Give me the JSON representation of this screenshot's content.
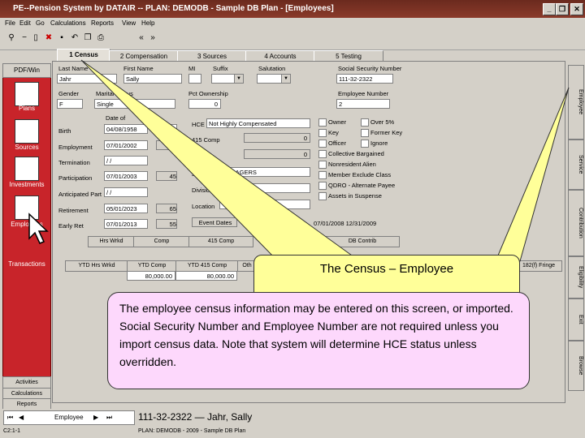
{
  "window": {
    "title": "PE--Pension System by DATAIR -- PLAN: DEMODB - Sample DB Plan - [Employees]",
    "minimize": "_",
    "restore": "❐",
    "close": "✕"
  },
  "menu": [
    "File",
    "Edit",
    "Go",
    "Calculations",
    "Reports",
    "View",
    "Help"
  ],
  "toolbar": {
    "prev": "«",
    "next": "»"
  },
  "sidebar": {
    "header": "PDF/Win",
    "items": [
      "Plans",
      "Sources",
      "Investments",
      "Employees",
      "Transactions"
    ],
    "bottom": [
      "Activities",
      "Calculations",
      "Reports"
    ]
  },
  "tabs": [
    "1 Census",
    "2 Compensation",
    "3 Sources",
    "4 Accounts",
    "5 Testing"
  ],
  "labels": {
    "last_name": "Last Name",
    "first_name": "First Name",
    "mi": "MI",
    "suffix": "Suffix",
    "salutation": "Salutation",
    "ssn": "Social Security Number",
    "gender": "Gender",
    "marital": "Marital Status",
    "pct_own": "Pct Ownership",
    "emp_num": "Employee Number",
    "date_of": "Date of",
    "birth": "Birth",
    "employment": "Employment",
    "termination": "Termination",
    "participation": "Participation",
    "ant_part": "Anticipated Part",
    "retirement": "Retirement",
    "early_ret": "Early Ret",
    "hce": "HCE",
    "c415": "415 Comp",
    "job": "Job",
    "division": "Division",
    "location": "Location",
    "event_dates": "Event Dates"
  },
  "values": {
    "last_name": "Jahr",
    "first_name": "Sally",
    "ssn": "111-32-2322",
    "gender": "F",
    "marital": "Single",
    "pct_own": "0",
    "emp_num": "2",
    "birth": "04/08/1958",
    "birth_age": "",
    "employment": "07/01/2002",
    "emp_yrs": "43",
    "termination": "/ /",
    "participation": "07/01/2003",
    "part_age": "45",
    "ant_part": "/ /",
    "retirement": "05/01/2023",
    "ret_age": "65",
    "early_ret": "07/01/2013",
    "early_age": "55",
    "hce": "Not Highly Compensated",
    "c415": "0",
    "ccomp": "0",
    "job": "MANAGERS",
    "range": "07/01/2008 12/31/2009"
  },
  "flags": [
    "Owner",
    "Over 5%",
    "Key",
    "Former Key",
    "Officer",
    "Ignore",
    "Collective Bargained",
    "Nonresident Alien",
    "Member Exclude Class",
    "QDRO - Alternate Payee",
    "Assets in Suspense"
  ],
  "right_tabs": [
    "Employee",
    "Service",
    "Contribution",
    "Eligibility",
    "Exit",
    "Browse"
  ],
  "grid": {
    "headers": [
      "Hrs Wrkd",
      "Comp",
      "415 Comp",
      "DB Contrib"
    ],
    "sub_headers": [
      "YTD Hrs Wrkd",
      "YTD Comp",
      "YTD 415 Comp",
      "Oth",
      "EP",
      "182(f) Fringe"
    ],
    "row": [
      "",
      "80,000.00",
      "80,000.00"
    ]
  },
  "callout_title": "The Census – Employee",
  "callout_text": "The employee census information may be entered on this screen, or imported.  Social Security Number and Employee Number are not required unless you import census data.  Note that system will determine HCE status unless overridden.",
  "status": {
    "record_label": "Employee",
    "record_info": "111-32-2322 — Jahr, Sally",
    "bottom": "DEMODB",
    "plan": "PLAN: DEMODB - 2009 - Sample DB Plan",
    "pos": "C2:1-1"
  }
}
